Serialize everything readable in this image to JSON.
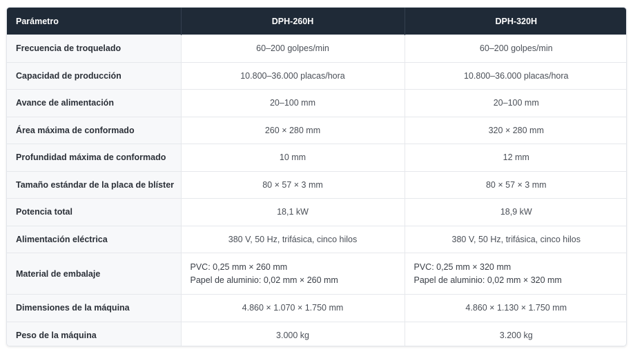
{
  "table": {
    "headers": [
      "Parámetro",
      "DPH-260H",
      "DPH-320H"
    ],
    "rows": [
      {
        "param": "Frecuencia de troquelado",
        "a": "60–200 golpes/min",
        "b": "60–200 golpes/min"
      },
      {
        "param": "Capacidad de producción",
        "a": "10.800–36.000 placas/hora",
        "b": "10.800–36.000 placas/hora"
      },
      {
        "param": "Avance de alimentación",
        "a": "20–100 mm",
        "b": "20–100 mm"
      },
      {
        "param": "Área máxima de conformado",
        "a": "260 × 280 mm",
        "b": "320 × 280 mm"
      },
      {
        "param": "Profundidad máxima de conformado",
        "a": "10 mm",
        "b": "12 mm"
      },
      {
        "param": "Tamaño estándar de la placa de blíster",
        "a": "80 × 57 × 3 mm",
        "b": "80 × 57 × 3 mm"
      },
      {
        "param": "Potencia total",
        "a": "18,1 kW",
        "b": "18,9 kW"
      },
      {
        "param": "Alimentación eléctrica",
        "a": "380 V, 50 Hz, trifásica, cinco hilos",
        "b": "380 V, 50 Hz, trifásica, cinco hilos"
      },
      {
        "param": "Material de embalaje",
        "a": [
          "PVC: 0,25 mm × 260 mm",
          "Papel de aluminio: 0,02 mm × 260 mm"
        ],
        "b": [
          "PVC: 0,25 mm × 320 mm",
          "Papel de aluminio: 0,02 mm × 320 mm"
        ]
      },
      {
        "param": "Dimensiones de la máquina",
        "a": "4.860 × 1.070 × 1.750 mm",
        "b": "4.860 × 1.130 × 1.750 mm"
      },
      {
        "param": "Peso de la máquina",
        "a": "3.000 kg",
        "b": "3.200 kg"
      }
    ]
  },
  "colors": {
    "header_bg": "#1f2a37",
    "header_text": "#ffffff",
    "param_bg": "#f7f8fa",
    "border": "#e6e8ec"
  }
}
